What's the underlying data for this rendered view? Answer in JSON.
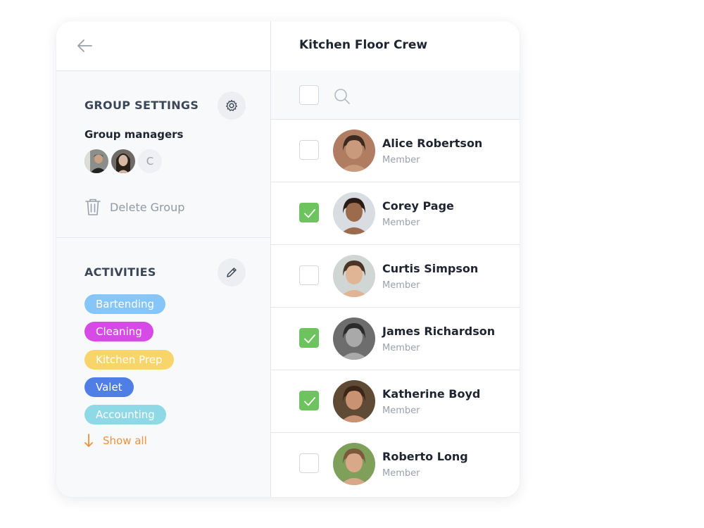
{
  "sidebar": {
    "group_settings_title": "GROUP SETTINGS",
    "group_managers_label": "Group managers",
    "managers": [
      {
        "type": "photo",
        "skin": "#c9a286",
        "hair": "#2b221c",
        "bg": "#8b8e8a"
      },
      {
        "type": "photo",
        "skin": "#d8b8a4",
        "hair": "#2a201a",
        "bg": "#6f6a66"
      },
      {
        "type": "initial",
        "initial": "C"
      }
    ],
    "delete_group_label": "Delete Group",
    "activities_title": "ACTIVITIES",
    "activities": [
      {
        "label": "Bartending",
        "color": "#86c5f7"
      },
      {
        "label": "Cleaning",
        "color": "#d64ae6"
      },
      {
        "label": "Kitchen Prep",
        "color": "#f7d56a"
      },
      {
        "label": "Valet",
        "color": "#4f7fe6"
      },
      {
        "label": "Accounting",
        "color": "#8fd8e6"
      }
    ],
    "show_all_label": "Show all"
  },
  "group": {
    "title": "Kitchen Floor Crew"
  },
  "members": [
    {
      "name": "Alice Robertson",
      "role": "Member",
      "checked": false,
      "skin": "#c99b7c",
      "hair": "#3a2a20",
      "bg": "#b07d62"
    },
    {
      "name": "Corey Page",
      "role": "Member",
      "checked": true,
      "skin": "#9c6b4e",
      "hair": "#2a1c14",
      "bg": "#d9dde2"
    },
    {
      "name": "Curtis Simpson",
      "role": "Member",
      "checked": false,
      "skin": "#e0b596",
      "hair": "#4a3526",
      "bg": "#cfd6d4"
    },
    {
      "name": "James Richardson",
      "role": "Member",
      "checked": true,
      "skin": "#a9a9a9",
      "hair": "#2b2b2b",
      "bg": "#6d6d6d"
    },
    {
      "name": "Katherine Boyd",
      "role": "Member",
      "checked": true,
      "skin": "#c99272",
      "hair": "#3d2518",
      "bg": "#5e4a35"
    },
    {
      "name": "Roberto Long",
      "role": "Member",
      "checked": false,
      "skin": "#d8a888",
      "hair": "#7a5a3a",
      "bg": "#7fa05a"
    }
  ],
  "colors": {
    "accent_orange": "#f0903c",
    "check_green": "#6dc45e",
    "border": "#e3e6ec",
    "panel_bg": "#f8f9fb"
  }
}
